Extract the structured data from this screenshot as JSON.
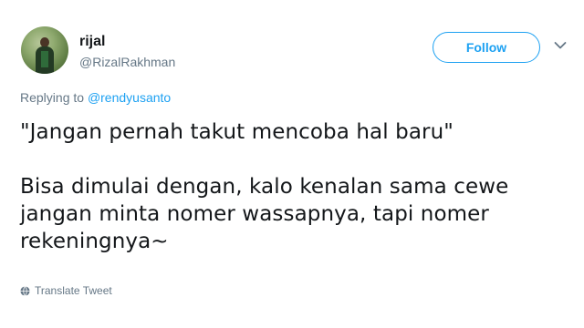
{
  "author": {
    "display_name": "rijal",
    "handle": "@RizalRakhman"
  },
  "actions": {
    "follow_label": "Follow"
  },
  "reply": {
    "prefix": "Replying to",
    "mention": "@rendyusanto"
  },
  "tweet": {
    "lines": [
      "\"Jangan pernah takut mencoba hal baru\"",
      "Bisa dimulai dengan, kalo kenalan sama cewe",
      "jangan minta nomer wassapnya, tapi nomer",
      "rekeningnya~"
    ]
  },
  "footer": {
    "translate_label": "Translate Tweet",
    "icon": "globe-icon"
  },
  "colors": {
    "accent": "#1da1f2",
    "secondary_text": "#657786",
    "primary_text": "#14171a"
  }
}
